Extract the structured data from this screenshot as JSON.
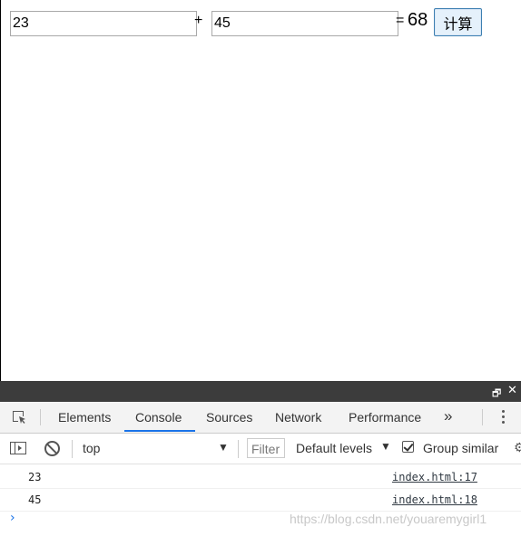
{
  "page": {
    "input_a": "23",
    "plus": "+",
    "input_b": "45",
    "equals": "=",
    "result": "68",
    "calc_button": "计算"
  },
  "devtools": {
    "tabs": [
      "Elements",
      "Console",
      "Sources",
      "Network",
      "Performance"
    ],
    "active_tab": "Console",
    "more_tabs": "»",
    "toolbar": {
      "context": "top",
      "filter_placeholder": "Filter",
      "levels": "Default levels",
      "group_similar": "Group similar",
      "group_similar_checked": true
    },
    "logs": [
      {
        "message": "23",
        "source": "index.html:17"
      },
      {
        "message": "45",
        "source": "index.html:18"
      }
    ],
    "prompt": "›"
  },
  "watermark": "https://blog.csdn.net/youaremygirl1",
  "colors": {
    "accent": "#1a73e8",
    "titlebar": "#3c3c3c",
    "tabbar": "#f3f3f3"
  }
}
